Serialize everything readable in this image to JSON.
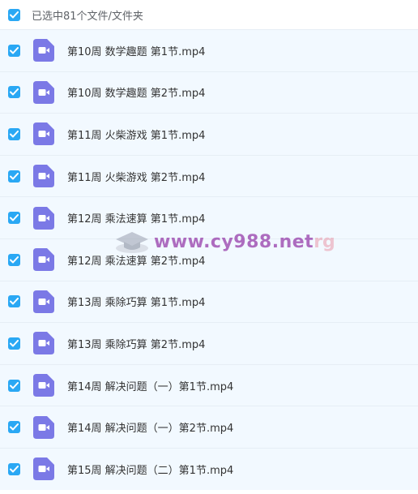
{
  "header": {
    "label": "已选中81个文件/文件夹",
    "checked": true
  },
  "files": [
    {
      "name": "第10周 数学趣题 第1节.mp4",
      "checked": true,
      "icon": "video-file-icon"
    },
    {
      "name": "第10周 数学趣题 第2节.mp4",
      "checked": true,
      "icon": "video-file-icon"
    },
    {
      "name": "第11周 火柴游戏 第1节.mp4",
      "checked": true,
      "icon": "video-file-icon"
    },
    {
      "name": "第11周 火柴游戏 第2节.mp4",
      "checked": true,
      "icon": "video-file-icon"
    },
    {
      "name": "第12周 乘法速算 第1节.mp4",
      "checked": true,
      "icon": "video-file-icon"
    },
    {
      "name": "第12周 乘法速算 第2节.mp4",
      "checked": true,
      "icon": "video-file-icon"
    },
    {
      "name": "第13周 乘除巧算 第1节.mp4",
      "checked": true,
      "icon": "video-file-icon"
    },
    {
      "name": "第13周 乘除巧算 第2节.mp4",
      "checked": true,
      "icon": "video-file-icon"
    },
    {
      "name": "第14周 解决问题（一）第1节.mp4",
      "checked": true,
      "icon": "video-file-icon"
    },
    {
      "name": "第14周 解决问题（一）第2节.mp4",
      "checked": true,
      "icon": "video-file-icon"
    },
    {
      "name": "第15周 解决问题（二）第1节.mp4",
      "checked": true,
      "icon": "video-file-icon"
    }
  ],
  "watermark": {
    "text": "www.cy988.net",
    "tail": "rg"
  },
  "colors": {
    "checkbox": "#2aa8f4",
    "video_icon": "#7b79e6",
    "row_bg": "#f2f9ff"
  }
}
